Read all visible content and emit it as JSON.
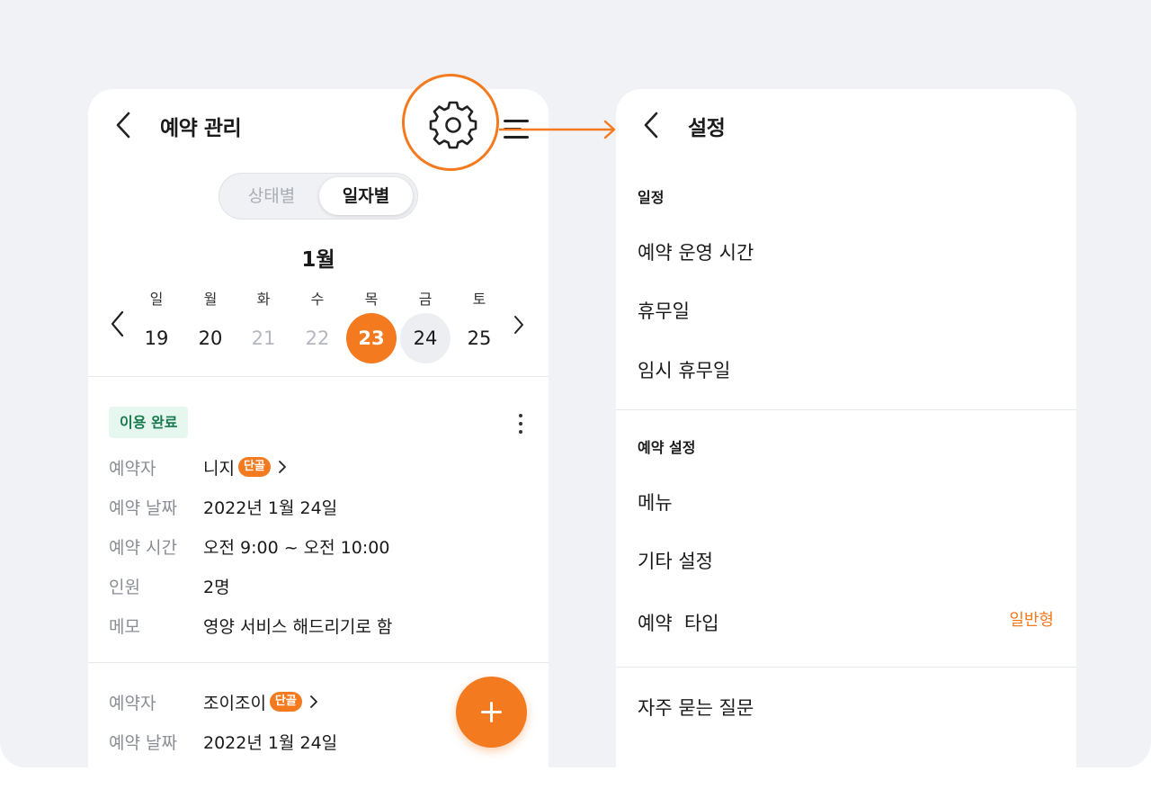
{
  "colors": {
    "accent": "#f47a1f",
    "success_bg": "#e6f7ef",
    "success_text": "#187a4d",
    "muted": "#b4b8be"
  },
  "left": {
    "title": "예약 관리",
    "segments": [
      "상태별",
      "일자별"
    ],
    "active_segment": "일자별",
    "month": "1월",
    "weekdays": [
      "일",
      "월",
      "화",
      "수",
      "목",
      "금",
      "토"
    ],
    "dates": [
      "19",
      "20",
      "21",
      "22",
      "23",
      "24",
      "25"
    ],
    "selected_date": "23",
    "booking1": {
      "status": "이용 완료",
      "labels": {
        "booker": "예약자",
        "date": "예약 날짜",
        "time": "예약 시간",
        "people": "인원",
        "memo": "메모"
      },
      "booker": "니지",
      "tag": "단골",
      "date": "2022년 1월 24일",
      "time": "오전 9:00 ~ 오전 10:00",
      "people": "2명",
      "memo": "영양 서비스 해드리기로 함"
    },
    "booking2": {
      "labels": {
        "booker": "예약자",
        "date": "예약 날짜"
      },
      "booker": "조이조이",
      "tag": "단골",
      "date": "2022년 1월 24일"
    }
  },
  "right": {
    "title": "설정",
    "sections": [
      {
        "title": "일정",
        "items": [
          "예약 운영 시간",
          "휴무일",
          "임시 휴무일"
        ]
      },
      {
        "title": "예약 설정",
        "items": [
          "메뉴",
          "기타 설정",
          "예약  타입"
        ]
      }
    ],
    "booking_type_value": "일반형",
    "faq": "자주 묻는 질문"
  }
}
